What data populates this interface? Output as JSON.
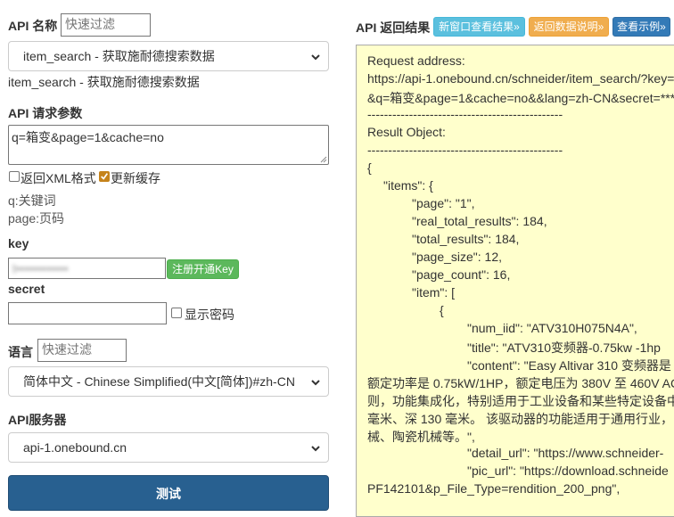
{
  "left": {
    "api_name_label": "API 名称",
    "api_filter_placeholder": "快速过滤",
    "api_select_value": "item_search - 获取施耐德搜索数据",
    "api_desc": "item_search - 获取施耐德搜索数据",
    "params_label": "API 请求参数",
    "params_value": "q=箱变&page=1&cache=no",
    "return_xml_label": "返回XML格式",
    "update_cache_label": "更新缓存",
    "hint_q": "q:关键词",
    "hint_page": "page:页码",
    "key_label": "key",
    "key_value": "t••••••••••••",
    "register_button": "注册开通Key",
    "secret_label": "secret",
    "show_password_label": "显示密码",
    "lang_label": "语言",
    "lang_filter_placeholder": "快速过滤",
    "lang_select_value": "简体中文 - Chinese Simplified(中文[简体])#zh-CN",
    "server_label": "API服务器",
    "server_select_value": "api-1.onebound.cn",
    "test_button": "测试"
  },
  "right": {
    "title": "API 返回结果",
    "btn_new_window": "新窗口查看结果»",
    "btn_return_doc": "返回数据说明»",
    "btn_example": "查看示例»",
    "lines": [
      "Request address:",
      "https://api-1.onebound.cn/schneider/item_search/?key=***",
      "&q=箱变&page=1&cache=no&&lang=zh-CN&secret=***",
      "-----------------------------------------------",
      "Result Object:",
      "-----------------------------------------------",
      "{",
      "    \"items\": {",
      "        \"page\": \"1\",",
      "        \"real_total_results\": 184,",
      "        \"total_results\": 184,",
      "        \"page_size\": 12,",
      "        \"page_count\": 16,",
      "        \"item\": [",
      "            {",
      "                \"num_iid\": \"ATV310H075N4A\",",
      "                \"title\": \"ATV310变频器-0.75kw -1hp",
      "                \"content\": \"Easy Altivar 310 变频器是",
      "额定功率是 0.75kW/1HP，额定电压为 380V 至 460V AC",
      "则，功能集成化，特别适用于工业设备和某些特定设备中",
      "毫米、深 130 毫米。 该驱动器的功能适用于通用行业，",
      "械、陶瓷机械等。\",",
      "                \"detail_url\": \"https://www.schneider-",
      "                \"pic_url\": \"https://download.schneide",
      "PF142101&p_File_Type=rendition_200_png\","
    ]
  },
  "colors": {
    "btn_blue": "#5bc0de",
    "btn_orange": "#f0ad4e",
    "btn_darkblue": "#337ab7",
    "register_green": "#5cb85c",
    "test_button": "#286090",
    "result_bg": "#ffffcc"
  }
}
